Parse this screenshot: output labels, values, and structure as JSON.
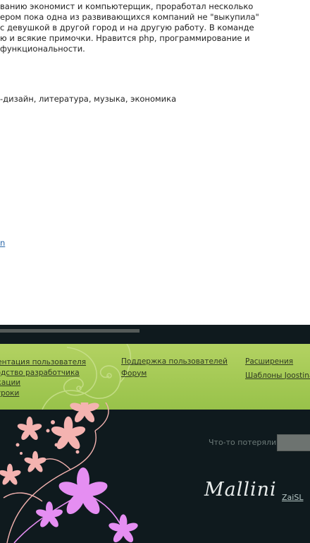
{
  "article": {
    "bio_lines": [
      "ванию экономист и компьютерщик, проработал несколько",
      "ером пока одна из развивающихся компаний не \"выкупила\"",
      "с девушкой в другой город и на другую работу. В команде",
      "ю и всякие примочки. Нравится php, программирование и",
      "функциональности."
    ],
    "interests": "-дизайн, литература, музыка, экономика",
    "link_fragment": "n"
  },
  "footer": {
    "links_col1": [
      "ументация пользователя",
      "оводство разработчика",
      "ликации",
      "еоуроки"
    ],
    "links_col2": [
      "Поддержка пользователей",
      "Форум"
    ],
    "links_col3": [
      "Расширения",
      "Шаблоны Joostina"
    ],
    "search_label": "Что-то потеряли?",
    "search_value": "",
    "brand": "Mallini",
    "author": "ZaiSL"
  },
  "colors": {
    "footer_bg": "#0f1a1e",
    "green_band": "#a8cc55",
    "flower_pink": "#f4b3b0",
    "flower_violet": "#e58ef2"
  },
  "icons": [
    "swirl-ornament",
    "flower-ornament"
  ]
}
